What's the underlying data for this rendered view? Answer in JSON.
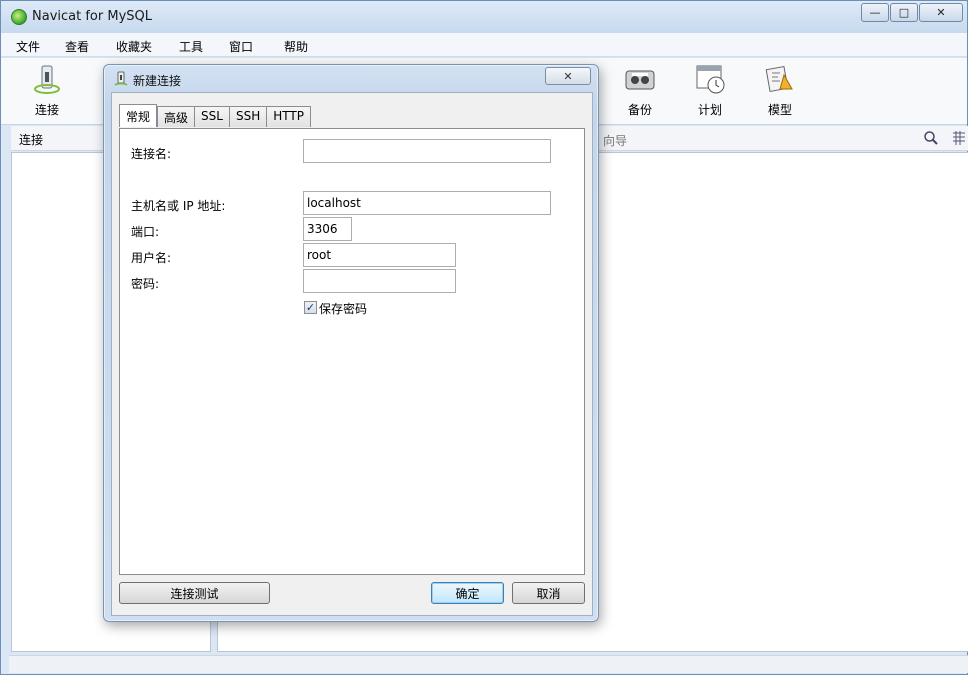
{
  "window": {
    "title": "Navicat for MySQL",
    "minimize": "—",
    "maximize": "□",
    "close": "✕"
  },
  "menu": [
    "文件",
    "查看",
    "收藏夹",
    "工具",
    "窗口",
    "帮助"
  ],
  "toolbar": {
    "connect": "连接",
    "backup": "备份",
    "schedule": "计划",
    "model": "模型"
  },
  "left_header": "连接",
  "right_header_hint": "向导",
  "dialog": {
    "title": "新建连接",
    "close": "✕",
    "tabs": [
      "常规",
      "高级",
      "SSL",
      "SSH",
      "HTTP"
    ],
    "active_tab": "常规",
    "fields": {
      "conn_name_label": "连接名:",
      "conn_name_value": "",
      "host_label": "主机名或 IP 地址:",
      "host_value": "localhost",
      "port_label": "端口:",
      "port_value": "3306",
      "user_label": "用户名:",
      "user_value": "root",
      "password_label": "密码:",
      "password_value": ""
    },
    "save_password": {
      "label": "保存密码",
      "checked": true,
      "mark": "✓"
    },
    "buttons": {
      "test": "连接测试",
      "ok": "确定",
      "cancel": "取消"
    }
  }
}
